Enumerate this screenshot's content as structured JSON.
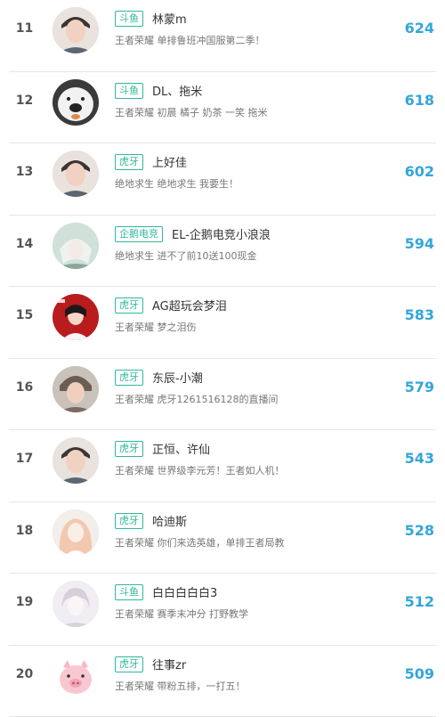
{
  "rows": [
    {
      "rank": "11",
      "tag": "斗鱼",
      "name": "林蒙m",
      "desc": "王者荣耀 单排鲁班冲国服第二季！",
      "score": "624",
      "avatar": "male-portrait-avatar"
    },
    {
      "rank": "12",
      "tag": "斗鱼",
      "name": "DL、拖米",
      "desc": "王者荣耀 初晨 橘子 奶茶 一笑 拖米",
      "score": "618",
      "avatar": "dog-face-avatar"
    },
    {
      "rank": "13",
      "tag": "虎牙",
      "name": "上好佳",
      "desc": "绝地求生 绝地求生 我要生！",
      "score": "602",
      "avatar": "male-portrait-avatar"
    },
    {
      "rank": "14",
      "tag": "企鹅电竞",
      "name": "EL-企鹅电竞小浪浪",
      "desc": "绝地求生 进不了前10送100现金",
      "score": "594",
      "avatar": "anime-character-avatar"
    },
    {
      "rank": "15",
      "tag": "虎牙",
      "name": "AG超玩会梦泪",
      "desc": "王者荣耀 梦之泪伤",
      "score": "583",
      "avatar": "red-poster-avatar"
    },
    {
      "rank": "16",
      "tag": "虎牙",
      "name": "东辰-小潮",
      "desc": "王者荣耀 虎牙1261516128的直播间",
      "score": "579",
      "avatar": "furry-hat-portrait-avatar"
    },
    {
      "rank": "17",
      "tag": "虎牙",
      "name": "正恒、许仙",
      "desc": "王者荣耀 世界级李元芳！王者如人机！",
      "score": "543",
      "avatar": "male-portrait-avatar"
    },
    {
      "rank": "18",
      "tag": "虎牙",
      "name": "哈迪斯",
      "desc": "王者荣耀 你们来选英雄，单排王者局教",
      "score": "528",
      "avatar": "anime-girl-avatar"
    },
    {
      "rank": "19",
      "tag": "斗鱼",
      "name": "白白白白白3",
      "desc": "王者荣耀 赛季末冲分 打野教学",
      "score": "512",
      "avatar": "sketch-portrait-avatar"
    },
    {
      "rank": "20",
      "tag": "虎牙",
      "name": "往事zr",
      "desc": "王者荣耀 带粉五排，一打五！",
      "score": "509",
      "avatar": "pig-cartoon-avatar"
    }
  ],
  "colors": {
    "tag": "#2fb99b",
    "score": "#34a6d8",
    "rank": "#555555"
  }
}
